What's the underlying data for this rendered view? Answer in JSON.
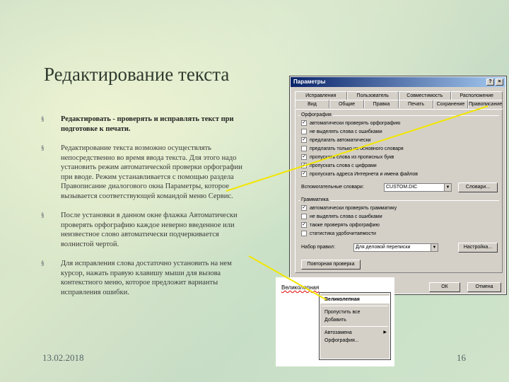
{
  "slide": {
    "title": "Редактирование текста",
    "date": "13.02.2018",
    "page": "16"
  },
  "bullets": [
    {
      "bold_lead": "Редактировать - проверять и исправлять текст при подготовке к печати.",
      "text": ""
    },
    {
      "bold_lead": "",
      "text": "Редактирование текста возможно осуществлять непосредственно во время ввода текста. Для этого надо установить режим автоматической проверки орфографии при вводе. Режим устанавливается с помощью раздела Правописание диалогового окна Параметры, которое вызывается соответствующей командой меню Сервис."
    },
    {
      "bold_lead": "",
      "text": "После установки в данном окне флажка Автоматически проверять орфографию каждое неверно введенное или неизвестное слово автоматически подчеркивается волнистой чертой."
    },
    {
      "bold_lead": "",
      "text": "Для исправления слова достаточно установить на нем курсор, нажать правую клавишу мыши для вызова контекстного меню, которое предложит варианты исправления ошибки."
    }
  ],
  "bullet_mark": "§",
  "dialog": {
    "title": "Параметры",
    "help_btn": "?",
    "close_btn": "×",
    "tabs_row1": [
      "Исправления",
      "Пользователь",
      "Совместимость",
      "Расположение"
    ],
    "tabs_row2": [
      "Вид",
      "Общие",
      "Правка",
      "Печать",
      "Сохранение",
      "Правописание"
    ],
    "group1": "Орфография",
    "checks1": [
      {
        "label": "автоматически проверять орфографию",
        "checked": true
      },
      {
        "label": "не выделять слова с ошибками",
        "checked": false
      },
      {
        "label": "предлагать автоматически",
        "checked": true
      },
      {
        "label": "предлагать только из основного словаря",
        "checked": false
      },
      {
        "label": "пропускать слова из прописных букв",
        "checked": true
      },
      {
        "label": "пропускать слова с цифрами",
        "checked": true
      },
      {
        "label": "пропускать адреса Интернета и имена файлов",
        "checked": true
      }
    ],
    "dict_label": "Вспомогательные словари:",
    "dict_value": "CUSTOM.DIC",
    "dict_btn": "Словари...",
    "group2": "Грамматика",
    "checks2": [
      {
        "label": "автоматически проверять грамматику",
        "checked": true
      },
      {
        "label": "не выделять слова с ошибками",
        "checked": false
      },
      {
        "label": "также проверять орфографию",
        "checked": true
      },
      {
        "label": "статистика удобочитаемости",
        "checked": false
      }
    ],
    "style_label": "Набор правил:",
    "style_value": "Для деловой переписки",
    "style_btn": "Настройка...",
    "recheck_btn": "Повторная проверка",
    "ok_btn": "ОК",
    "cancel_btn": "Отмена"
  },
  "context": {
    "word": "Великолепная",
    "items": [
      {
        "label": "Великолепная",
        "bold": true,
        "submenu": false
      },
      {
        "label": "Пропустить все",
        "bold": false,
        "submenu": false
      },
      {
        "label": "Добавить",
        "bold": false,
        "submenu": false
      },
      {
        "label": "Автозамена",
        "bold": false,
        "submenu": true
      },
      {
        "label": "Орфография...",
        "bold": false,
        "submenu": false
      }
    ],
    "submenu_arrow": "▶"
  },
  "colors": {
    "pointer_line": "#f2e600",
    "title_bar": "#0a246a"
  }
}
